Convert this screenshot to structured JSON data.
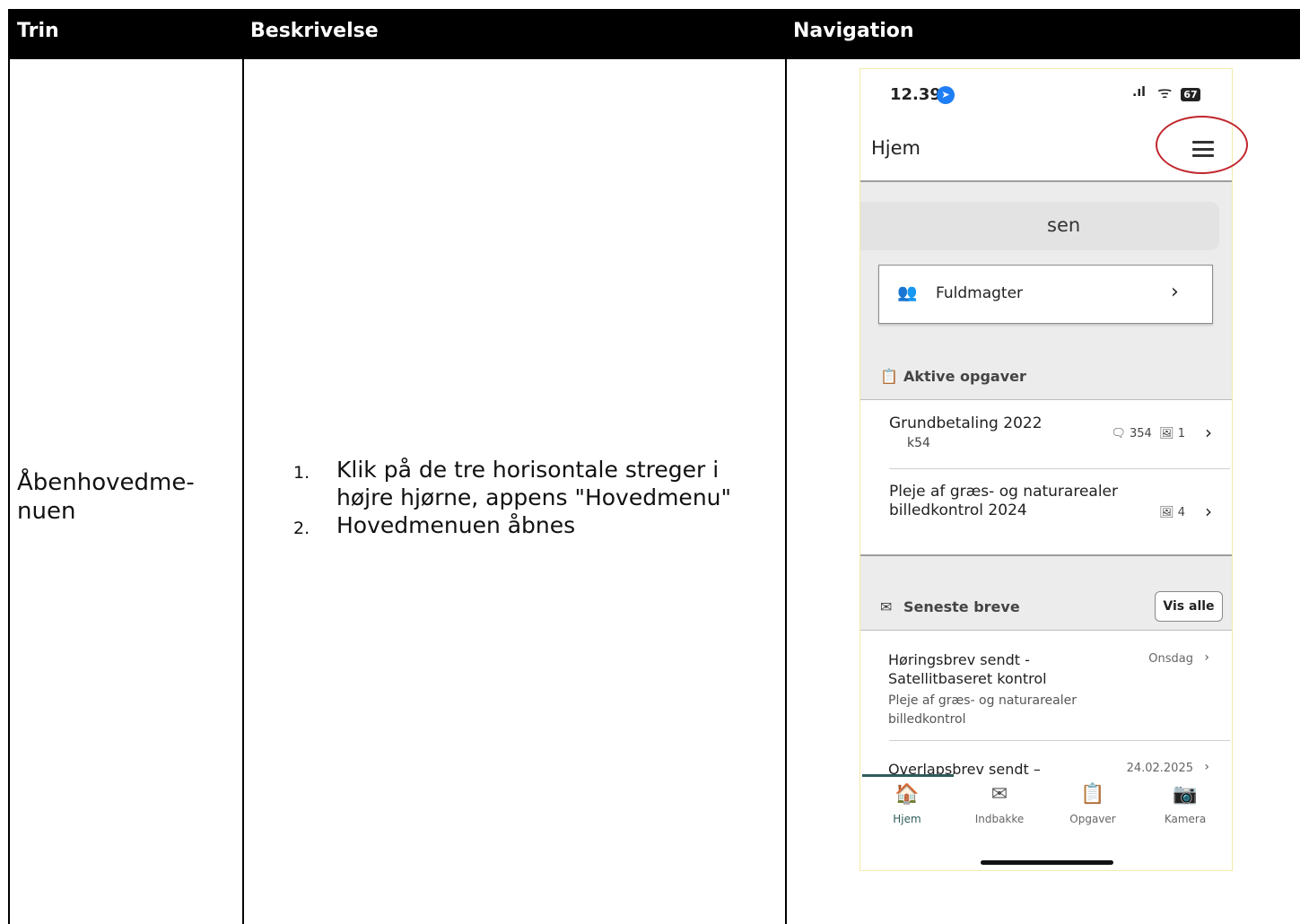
{
  "table": {
    "headers": [
      "Trin",
      "Beskrivelse",
      "Navigation"
    ],
    "step": "Åbenhovedme-\nnuen",
    "step_lines": [
      "Åbenhovedme-",
      "nuen"
    ],
    "description": [
      {
        "num": "1.",
        "text": "Klik på de tre horisontale streger i højre hjørne, appens \"Hovedmenu\""
      },
      {
        "num": "2.",
        "text": "Hovedmenuen åbnes"
      }
    ]
  },
  "phone": {
    "status": {
      "time": "12.39",
      "battery": "67"
    },
    "title": "Hjem",
    "name_fragment": "sen",
    "fuldmagter": "Fuldmagter",
    "active_tasks": {
      "heading": "Aktive opgaver",
      "items": [
        {
          "title": "Grundbetaling 2022",
          "sub": "k54",
          "comments": "354",
          "images": "1"
        },
        {
          "title": "Pleje af græs- og naturarealer billedkontrol 2024",
          "images": "4"
        }
      ]
    },
    "letters": {
      "heading": "Seneste breve",
      "button": "Vis alle",
      "items": [
        {
          "title": "Høringsbrev sendt - Satellitbaseret kontrol",
          "sub": "Pleje af græs- og naturarealer billedkontrol",
          "date": "Onsdag"
        },
        {
          "title": "Overlapsbrev sendt –",
          "date": "24.02.2025"
        }
      ]
    },
    "nav": [
      {
        "label": "Hjem",
        "icon": "home-icon",
        "active": true
      },
      {
        "label": "Indbakke",
        "icon": "mail-icon",
        "active": false
      },
      {
        "label": "Opgaver",
        "icon": "clipboard-icon",
        "active": false
      },
      {
        "label": "Kamera",
        "icon": "camera-icon",
        "active": false
      }
    ],
    "colors": {
      "accent": "#2e5d5a",
      "highlight": "#c0272d",
      "location": "#1e7ef5"
    }
  }
}
